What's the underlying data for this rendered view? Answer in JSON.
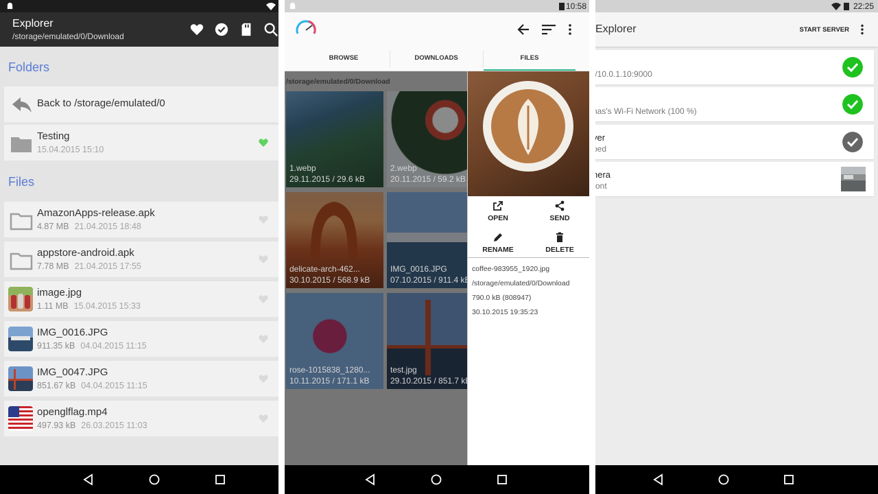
{
  "panel1": {
    "status_icon": "android-icon",
    "title": "Explorer",
    "path": "/storage/emulated/0/Download",
    "folders_heading": "Folders",
    "back_label": "Back to /storage/emulated/0",
    "folders": [
      {
        "name": "Testing",
        "date": "15.04.2015 15:10",
        "favorite": true
      }
    ],
    "files_heading": "Files",
    "files": [
      {
        "name": "AmazonApps-release.apk",
        "size": "4.87 MB",
        "date": "21.04.2015 18:48",
        "icon": "folder-icon"
      },
      {
        "name": "appstore-android.apk",
        "size": "7.78 MB",
        "date": "21.04.2015 17:55",
        "icon": "folder-icon"
      },
      {
        "name": "image.jpg",
        "size": "1.11 MB",
        "date": "15.04.2015 15:33",
        "icon": "photo-thumbnail"
      },
      {
        "name": "IMG_0016.JPG",
        "size": "911.35 kB",
        "date": "04.04.2015 11:15",
        "icon": "photo-thumbnail"
      },
      {
        "name": "IMG_0047.JPG",
        "size": "851.67 kB",
        "date": "04.04.2015 11:15",
        "icon": "photo-thumbnail"
      },
      {
        "name": "openglflag.mp4",
        "size": "497.93 kB",
        "date": "26.03.2015 11:03",
        "icon": "flag-thumbnail"
      }
    ],
    "accent": "#5c7bd6",
    "favorite_color": "#5fd35f"
  },
  "panel2": {
    "time": "10:58",
    "tabs": [
      "BROWSE",
      "DOWNLOADS",
      "FILES"
    ],
    "active_tab": "FILES",
    "path": "/storage/emulated/0/Download",
    "tiles": [
      {
        "name": "1.webp",
        "info": "29.11.2015 / 29.6 kB"
      },
      {
        "name": "2.webp",
        "info": "20.11.2015 / 59.2 kB"
      },
      {
        "name": "delicate-arch-462...",
        "info": "30.10.2015 / 568.9 kB"
      },
      {
        "name": "IMG_0016.JPG",
        "info": "07.10.2015 / 911.4 kB"
      },
      {
        "name": "rose-1015838_1280...",
        "info": "10.11.2015 / 171.1 kB"
      },
      {
        "name": "test.jpg",
        "info": "29.10.2015 / 851.7 kB"
      }
    ],
    "actions": {
      "open": "OPEN",
      "send": "SEND",
      "rename": "RENAME",
      "delete": "DELETE"
    },
    "details": {
      "filename": "coffee-983955_1920.jpg",
      "path": "/storage/emulated/0/Download",
      "size": "790.0 kB (808947)",
      "date": "30.10.2015 19:35:23"
    },
    "accent": "#2bb58a"
  },
  "panel3": {
    "time": "22:25",
    "title": "i Explorer",
    "start_server": "START SERVER",
    "cards": [
      {
        "line1": "",
        "line2": "//10.0.1.10:9000",
        "status": "ok"
      },
      {
        "line1": "",
        "line2": "nas's Wi-Fi Network (100 %)",
        "status": "ok"
      },
      {
        "line1": "ver",
        "line2": "ped",
        "status": "stopped"
      },
      {
        "line1": "nera",
        "line2": "ront",
        "status": "thumbnail"
      }
    ],
    "ok_color": "#1fc21f",
    "stopped_color": "#666666"
  }
}
